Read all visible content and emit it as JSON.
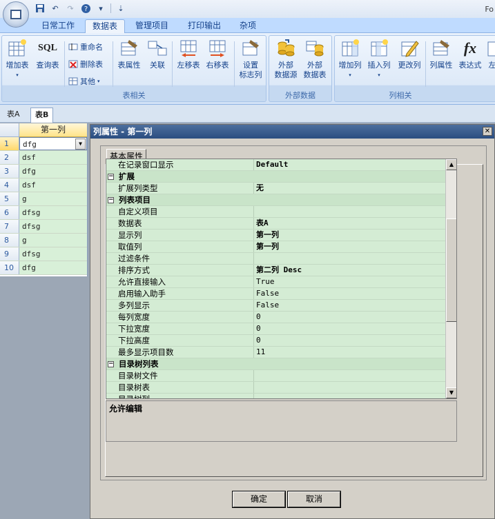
{
  "app": {
    "title_fragment": "Fo"
  },
  "qat": {
    "icons": [
      "save-icon",
      "undo-icon",
      "redo-icon",
      "help-icon",
      "customize-icon"
    ]
  },
  "ribbon": {
    "tabs": [
      "日常工作",
      "数据表",
      "管理项目",
      "打印输出",
      "杂项"
    ],
    "active_tab": "数据表",
    "groups": {
      "table": {
        "label": "表相关",
        "add_table": "增加表",
        "query_table": "查询表",
        "rename": "重命名",
        "delete_table": "删除表",
        "other": "其他",
        "table_props": "表属性",
        "relation": "关联",
        "move_left": "左移表",
        "move_right": "右移表",
        "set_flag_col_1": "设置",
        "set_flag_col_2": "标志列"
      },
      "external": {
        "label": "外部数据",
        "ext_source_1": "外部",
        "ext_source_2": "数据源",
        "ext_table_1": "外部",
        "ext_table_2": "数据表"
      },
      "column": {
        "label": "列相关",
        "add_col": "增加列",
        "insert_col": "插入列",
        "change_col": "更改列",
        "col_props": "列属性",
        "expression": "表达式",
        "cut_off": "左"
      }
    }
  },
  "sheets": {
    "tabs": [
      "表A",
      "表B"
    ],
    "active": "表B"
  },
  "grid": {
    "column_header": "第一列",
    "rows": [
      {
        "n": "1",
        "v": "dfg"
      },
      {
        "n": "2",
        "v": "dsf"
      },
      {
        "n": "3",
        "v": "dfg"
      },
      {
        "n": "4",
        "v": "dsf"
      },
      {
        "n": "5",
        "v": "g"
      },
      {
        "n": "6",
        "v": "dfsg"
      },
      {
        "n": "7",
        "v": "dfsg"
      },
      {
        "n": "8",
        "v": "g"
      },
      {
        "n": "9",
        "v": "dfsg"
      },
      {
        "n": "10",
        "v": "dfg"
      }
    ]
  },
  "dialog": {
    "title": "列属性 - 第一列",
    "tab": "基本属性",
    "rows": [
      {
        "type": "prop",
        "name": "在记录窗口显示",
        "value": "Default",
        "bold": true
      },
      {
        "type": "cat",
        "name": "扩展"
      },
      {
        "type": "prop",
        "name": "扩展列类型",
        "value": "无",
        "bold": true
      },
      {
        "type": "cat",
        "name": "列表项目"
      },
      {
        "type": "prop",
        "name": "自定义项目",
        "value": "",
        "bold": false
      },
      {
        "type": "prop",
        "name": "数据表",
        "value": "表A",
        "bold": true
      },
      {
        "type": "prop",
        "name": "显示列",
        "value": "第一列",
        "bold": true
      },
      {
        "type": "prop",
        "name": "取值列",
        "value": "第一列",
        "bold": true
      },
      {
        "type": "prop",
        "name": "过滤条件",
        "value": "",
        "bold": false
      },
      {
        "type": "prop",
        "name": "排序方式",
        "value": "第二列 Desc",
        "bold": true
      },
      {
        "type": "prop",
        "name": "允许直接输入",
        "value": "True",
        "bold": false
      },
      {
        "type": "prop",
        "name": "启用输入助手",
        "value": "False",
        "bold": false
      },
      {
        "type": "prop",
        "name": "多列显示",
        "value": "False",
        "bold": false
      },
      {
        "type": "prop",
        "name": "每列宽度",
        "value": "0",
        "bold": false
      },
      {
        "type": "prop",
        "name": "下拉宽度",
        "value": "0",
        "bold": false
      },
      {
        "type": "prop",
        "name": "下拉高度",
        "value": "0",
        "bold": false
      },
      {
        "type": "prop",
        "name": "最多显示项目数",
        "value": "11",
        "bold": false
      },
      {
        "type": "cat",
        "name": "目录树列表"
      },
      {
        "type": "prop",
        "name": "目录树文件",
        "value": "",
        "bold": false
      },
      {
        "type": "prop",
        "name": "目录树表",
        "value": "",
        "bold": false
      },
      {
        "type": "prop",
        "name": "目录树列",
        "value": "",
        "bold": false
      }
    ],
    "description": "允许编辑",
    "ok": "确定",
    "cancel": "取消"
  }
}
